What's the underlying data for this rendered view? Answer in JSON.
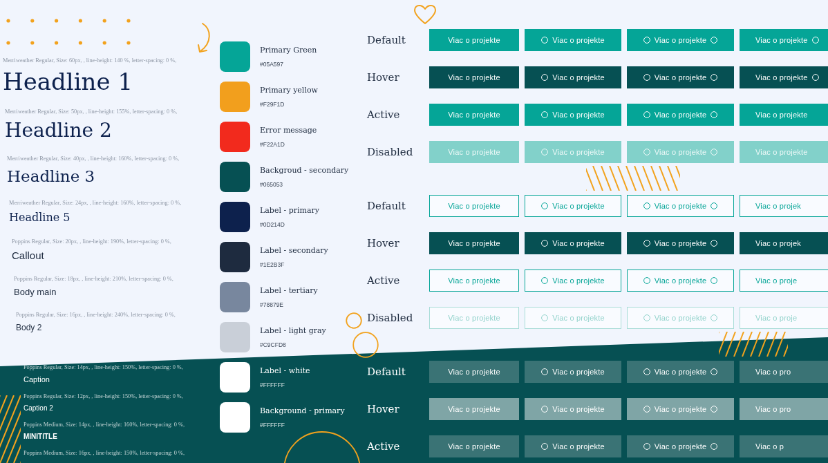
{
  "type_styles": [
    {
      "spec": "Merriweather Regular, Size: 60px, , line-height: 140 %, letter-spacing: 0 %,",
      "sample": "Headline 1",
      "kind": "h1",
      "on_dark": false
    },
    {
      "spec": "Merriweather Regular, Size: 50px, , line-height: 155%, letter-spacing: 0 %,",
      "sample": "Headline 2",
      "kind": "h2",
      "on_dark": false
    },
    {
      "spec": "Merriweather Regular, Size: 40px, , line-height: 160%, letter-spacing: 0 %,",
      "sample": "Headline 3",
      "kind": "h3",
      "on_dark": false
    },
    {
      "spec": "Merriweather Regular, Size: 24px, , line-height: 160%, letter-spacing: 0 %,",
      "sample": "Headline 5",
      "kind": "h5",
      "on_dark": false
    },
    {
      "spec": "Poppins Regular, Size: 20px, , line-height: 190%, letter-spacing: 0 %,",
      "sample": "Callout",
      "kind": "callout",
      "on_dark": false
    },
    {
      "spec": "Poppins Regular, Size: 18px, , line-height: 210%, letter-spacing: 0 %,",
      "sample": "Body main",
      "kind": "body",
      "on_dark": false
    },
    {
      "spec": "Poppins Regular, Size: 16px, , line-height: 240%, letter-spacing: 0 %,",
      "sample": "Body 2",
      "kind": "body2",
      "on_dark": false
    },
    {
      "spec": "Poppins Regular, Size: 14px, , line-height: 150%, letter-spacing: 0 %,",
      "sample": "Caption",
      "kind": "caption",
      "on_dark": true
    },
    {
      "spec": "Poppins Regular, Size: 12px, , line-height: 150%, letter-spacing: 0 %,",
      "sample": "Caption 2",
      "kind": "caption2",
      "on_dark": true
    },
    {
      "spec": "Poppins Medium, Size: 14px, , line-height: 160%, letter-spacing: 0 %,",
      "sample": "MINITITLE",
      "kind": "minititle",
      "on_dark": true
    },
    {
      "spec": "Poppins Medium, Size: 16px, , line-height: 150%, letter-spacing: 0 %,",
      "kind": "spec_only",
      "on_dark": true
    }
  ],
  "colors": [
    {
      "name": "Primary Green",
      "hex": "#05A597",
      "color": "#05a597",
      "on_dark": false
    },
    {
      "name": "Primary yellow",
      "hex": "#F29F1D",
      "color": "#f29f1d",
      "on_dark": false
    },
    {
      "name": "Error message",
      "hex": "#F22A1D",
      "color": "#f22a1d",
      "on_dark": false
    },
    {
      "name": "Backgroud - secondary",
      "hex": "#065053",
      "color": "#065053",
      "on_dark": false
    },
    {
      "name": "Label - primary",
      "hex": "#0D214D",
      "color": "#0d214d",
      "on_dark": false
    },
    {
      "name": "Label - secondary",
      "hex": "#1E2B3F",
      "color": "#1e2b3f",
      "on_dark": false
    },
    {
      "name": "Label - tertiary",
      "hex": "#78879E",
      "color": "#78879e",
      "on_dark": false
    },
    {
      "name": "Label - light gray",
      "hex": "#C9CFD8",
      "color": "#c9cfd8",
      "on_dark": false
    },
    {
      "name": "Label - white",
      "hex": "#FFFFFF",
      "color": "#ffffff",
      "on_dark": true
    },
    {
      "name": "Background - primary",
      "hex": "#FFFFFF",
      "color": "#ffffff",
      "on_dark": true
    }
  ],
  "button_groups": [
    {
      "kind": "filled",
      "rows": [
        {
          "state": "Default",
          "kind": "default",
          "buttons": [
            {
              "label": "Viac o projekte",
              "kind": "plain"
            },
            {
              "label": "Viac o projekte",
              "kind": "icon_left"
            },
            {
              "label": "Viac o projekte",
              "kind": "icons_both"
            },
            {
              "label": "Viac o projekte",
              "kind": "icon_right"
            }
          ]
        },
        {
          "state": "Hover",
          "kind": "hover",
          "buttons": [
            {
              "label": "Viac o projekte",
              "kind": "plain"
            },
            {
              "label": "Viac o projekte",
              "kind": "icon_left"
            },
            {
              "label": "Viac o projekte",
              "kind": "icons_both"
            },
            {
              "label": "Viac o projekte",
              "kind": "icon_right"
            }
          ]
        },
        {
          "state": "Active",
          "kind": "active",
          "buttons": [
            {
              "label": "Viac o projekte",
              "kind": "plain"
            },
            {
              "label": "Viac o projekte",
              "kind": "icon_left"
            },
            {
              "label": "Viac o projekte",
              "kind": "icons_both"
            },
            {
              "label": "Viac o projekte",
              "kind": "plain"
            }
          ]
        },
        {
          "state": "Disabled",
          "kind": "disabled",
          "buttons": [
            {
              "label": "Viac o projekte",
              "kind": "plain"
            },
            {
              "label": "Viac o projekte",
              "kind": "icon_left"
            },
            {
              "label": "Viac o projekte",
              "kind": "icons_both"
            },
            {
              "label": "Viac o projekte",
              "kind": "plain"
            }
          ]
        }
      ]
    },
    {
      "kind": "outline",
      "rows": [
        {
          "state": "Default",
          "kind": "default",
          "buttons": [
            {
              "label": "Viac o projekte",
              "kind": "plain"
            },
            {
              "label": "Viac o projekte",
              "kind": "icon_left"
            },
            {
              "label": "Viac o projekte",
              "kind": "icons_both"
            },
            {
              "label": "Viac o projek",
              "kind": "plain"
            }
          ]
        },
        {
          "state": "Hover",
          "kind": "hover",
          "buttons": [
            {
              "label": "Viac o projekte",
              "kind": "plain"
            },
            {
              "label": "Viac o projekte",
              "kind": "icon_left"
            },
            {
              "label": "Viac o projekte",
              "kind": "icons_both"
            },
            {
              "label": "Viac o projek",
              "kind": "plain"
            }
          ]
        },
        {
          "state": "Active",
          "kind": "active",
          "buttons": [
            {
              "label": "Viac o projekte",
              "kind": "plain"
            },
            {
              "label": "Viac o projekte",
              "kind": "icon_left"
            },
            {
              "label": "Viac o projekte",
              "kind": "icons_both"
            },
            {
              "label": "Viac o proje",
              "kind": "plain"
            }
          ]
        },
        {
          "state": "Disabled",
          "kind": "disabled",
          "buttons": [
            {
              "label": "Viac o projekte",
              "kind": "plain"
            },
            {
              "label": "Viac o projekte",
              "kind": "icon_left"
            },
            {
              "label": "Viac o projekte",
              "kind": "icons_both"
            },
            {
              "label": "Viac o proje",
              "kind": "plain"
            }
          ]
        }
      ]
    },
    {
      "kind": "inverse",
      "rows": [
        {
          "state": "Default",
          "kind": "default",
          "buttons": [
            {
              "label": "Viac o projekte",
              "kind": "plain"
            },
            {
              "label": "Viac o projekte",
              "kind": "icon_left"
            },
            {
              "label": "Viac o projekte",
              "kind": "icons_both"
            },
            {
              "label": "Viac o pro",
              "kind": "plain"
            }
          ]
        },
        {
          "state": "Hover",
          "kind": "hover",
          "buttons": [
            {
              "label": "Viac o projekte",
              "kind": "plain"
            },
            {
              "label": "Viac o projekte",
              "kind": "icon_left"
            },
            {
              "label": "Viac o projekte",
              "kind": "icons_both"
            },
            {
              "label": "Viac o pro",
              "kind": "plain"
            }
          ]
        },
        {
          "state": "Active",
          "kind": "active",
          "buttons": [
            {
              "label": "Viac o projekte",
              "kind": "plain"
            },
            {
              "label": "Viac o projekte",
              "kind": "icon_left"
            },
            {
              "label": "Viac o projekte",
              "kind": "icons_both"
            },
            {
              "label": "Viac o p",
              "kind": "plain"
            }
          ]
        }
      ]
    }
  ]
}
